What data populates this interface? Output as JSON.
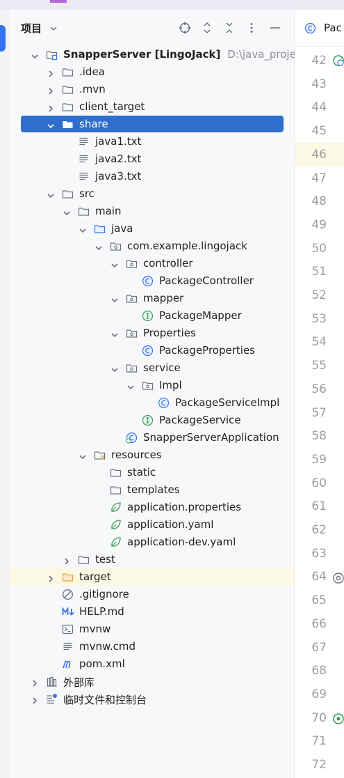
{
  "panel": {
    "title": "项目"
  },
  "toolbar": [
    "locate-icon",
    "expand-all-icon",
    "collapse-all-icon",
    "more-options-icon",
    "minimize-icon"
  ],
  "editor": {
    "tab_label": "Pac",
    "line_numbers": [
      "42",
      "43",
      "44",
      "45",
      "46",
      "47",
      "48",
      "49",
      "50",
      "51",
      "52",
      "53",
      "54",
      "55",
      "56",
      "57",
      "58",
      "59",
      "60",
      "61",
      "62",
      "63",
      "64",
      "65",
      "66",
      "67",
      "68",
      "69",
      "70",
      "71",
      "72"
    ],
    "current_line": "46"
  },
  "tree": [
    {
      "label": "SnapperServer [LingoJack]",
      "path": "D:\\java_project\\S",
      "depth": 0,
      "arrow": "down",
      "icon": "module-folder-icon",
      "bold": true
    },
    {
      "label": ".idea",
      "depth": 1,
      "arrow": "right",
      "icon": "folder-icon"
    },
    {
      "label": ".mvn",
      "depth": 1,
      "arrow": "right",
      "icon": "folder-icon"
    },
    {
      "label": "client_target",
      "depth": 1,
      "arrow": "right",
      "icon": "folder-icon"
    },
    {
      "label": "share",
      "depth": 1,
      "arrow": "down",
      "icon": "folder-icon",
      "selected": true
    },
    {
      "label": "java1.txt",
      "depth": 2,
      "arrow": "none",
      "icon": "text-file-icon"
    },
    {
      "label": "java2.txt",
      "depth": 2,
      "arrow": "none",
      "icon": "text-file-icon"
    },
    {
      "label": "java3.txt",
      "depth": 2,
      "arrow": "none",
      "icon": "text-file-icon"
    },
    {
      "label": "src",
      "depth": 1,
      "arrow": "down",
      "icon": "folder-icon"
    },
    {
      "label": "main",
      "depth": 2,
      "arrow": "down",
      "icon": "folder-icon"
    },
    {
      "label": "java",
      "depth": 3,
      "arrow": "down",
      "icon": "source-folder-icon"
    },
    {
      "label": "com.example.lingojack",
      "depth": 4,
      "arrow": "down",
      "icon": "package-icon"
    },
    {
      "label": "controller",
      "depth": 5,
      "arrow": "down",
      "icon": "package-icon"
    },
    {
      "label": "PackageController",
      "depth": 6,
      "arrow": "none",
      "icon": "class-icon"
    },
    {
      "label": "mapper",
      "depth": 5,
      "arrow": "down",
      "icon": "package-icon"
    },
    {
      "label": "PackageMapper",
      "depth": 6,
      "arrow": "none",
      "icon": "interface-icon"
    },
    {
      "label": "Properties",
      "depth": 5,
      "arrow": "down",
      "icon": "package-icon"
    },
    {
      "label": "PackageProperties",
      "depth": 6,
      "arrow": "none",
      "icon": "class-icon"
    },
    {
      "label": "service",
      "depth": 5,
      "arrow": "down",
      "icon": "package-icon"
    },
    {
      "label": "Impl",
      "depth": 6,
      "arrow": "down",
      "icon": "package-icon"
    },
    {
      "label": "PackageServiceImpl",
      "depth": 7,
      "arrow": "none",
      "icon": "class-icon"
    },
    {
      "label": "PackageService",
      "depth": 6,
      "arrow": "none",
      "icon": "interface-icon"
    },
    {
      "label": "SnapperServerApplication",
      "depth": 5,
      "arrow": "none",
      "icon": "spring-app-icon"
    },
    {
      "label": "resources",
      "depth": 3,
      "arrow": "down",
      "icon": "resources-folder-icon"
    },
    {
      "label": "static",
      "depth": 4,
      "arrow": "none",
      "icon": "folder-icon"
    },
    {
      "label": "templates",
      "depth": 4,
      "arrow": "none",
      "icon": "folder-icon"
    },
    {
      "label": "application.properties",
      "depth": 4,
      "arrow": "none",
      "icon": "spring-config-icon"
    },
    {
      "label": "application.yaml",
      "depth": 4,
      "arrow": "none",
      "icon": "spring-config-icon"
    },
    {
      "label": "application-dev.yaml",
      "depth": 4,
      "arrow": "none",
      "icon": "spring-config-icon"
    },
    {
      "label": "test",
      "depth": 2,
      "arrow": "right",
      "icon": "folder-icon"
    },
    {
      "label": "target",
      "depth": 1,
      "arrow": "right",
      "icon": "excluded-folder-icon",
      "highlight": true
    },
    {
      "label": ".gitignore",
      "depth": 1,
      "arrow": "none",
      "icon": "ignore-file-icon"
    },
    {
      "label": "HELP.md",
      "depth": 1,
      "arrow": "none",
      "icon": "markdown-icon"
    },
    {
      "label": "mvnw",
      "depth": 1,
      "arrow": "none",
      "icon": "shell-script-icon"
    },
    {
      "label": "mvnw.cmd",
      "depth": 1,
      "arrow": "none",
      "icon": "text-file-icon"
    },
    {
      "label": "pom.xml",
      "depth": 1,
      "arrow": "none",
      "icon": "maven-icon"
    },
    {
      "label": "外部库",
      "depth": 0,
      "arrow": "right",
      "icon": "library-icon"
    },
    {
      "label": "临时文件和控制台",
      "depth": 0,
      "arrow": "right",
      "icon": "scratches-icon"
    }
  ]
}
